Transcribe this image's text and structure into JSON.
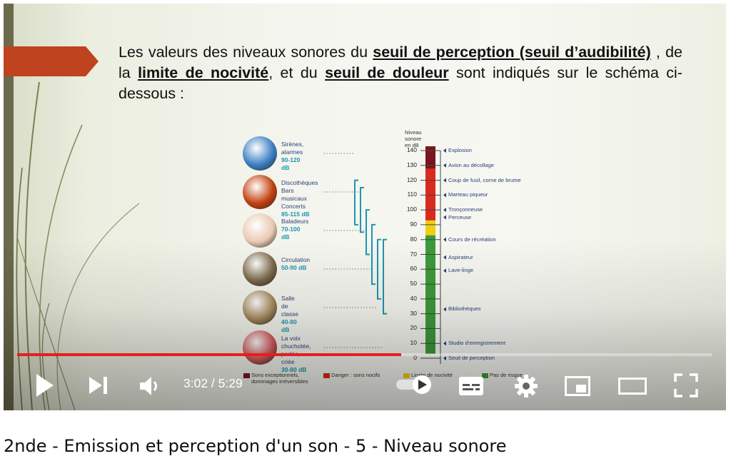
{
  "video": {
    "title": "2nde - Emission et perception d'un son - 5 - Niveau sonore",
    "current_time": "3:02",
    "separator": " / ",
    "duration": "5:29",
    "progress": 0.553
  },
  "controls": {
    "play": "play-icon",
    "next": "next-icon",
    "volume": "volume-icon",
    "autoplay": "autoplay-toggle",
    "subtitles": "subtitles-icon",
    "settings": "gear-icon",
    "miniplayer": "miniplayer-icon",
    "theater": "theater-icon",
    "fullscreen": "fullscreen-icon"
  },
  "slide": {
    "text_before": "Les valeurs des niveaux sonores du ",
    "term1": "seuil de perception (seuil d’audibilité)",
    "text_mid1": " , de la ",
    "term2": "limite de nocivité",
    "text_mid2": ", et du ",
    "term3": "seuil de douleur",
    "text_after": " sont indiqués sur le schéma ci-dessous :",
    "accent_color": "#c0431f",
    "diagram": {
      "scale_title": "Niveau sonore en dB",
      "ticks": [
        "140",
        "130",
        "120",
        "110",
        "100",
        "90",
        "80",
        "70",
        "60",
        "50",
        "40",
        "30",
        "20",
        "10",
        "0"
      ],
      "categories": [
        {
          "lines": [
            "Sirènes, alarmes"
          ],
          "range": "90-120 dB",
          "icon": "siren-icon"
        },
        {
          "lines": [
            "Discothèques",
            "Bars musicaux",
            "Concerts"
          ],
          "range": "85-115 dB",
          "icon": "concert-icon"
        },
        {
          "lines": [
            "Baladeurs"
          ],
          "range": "70-100 dB",
          "icon": "earphone-icon"
        },
        {
          "lines": [
            "Circulation"
          ],
          "range": "50-90 dB",
          "icon": "traffic-icon"
        },
        {
          "lines": [
            "Salle de classe"
          ],
          "range": "40-80 dB",
          "icon": "classroom-icon"
        },
        {
          "lines": [
            "La voix chuchotée,",
            "parlée, criée"
          ],
          "range": "30-80 dB",
          "icon": "mouth-icon"
        }
      ],
      "events": [
        {
          "db": 140,
          "label": "Explosion"
        },
        {
          "db": 130,
          "label": "Avion au décollage"
        },
        {
          "db": 120,
          "label": "Coup de fusil, corne de brume"
        },
        {
          "db": 110,
          "label": "Marteau piqueur"
        },
        {
          "db": 100,
          "label": "Tronçonneuse"
        },
        {
          "db": 95,
          "label": "Perceuse"
        },
        {
          "db": 80,
          "label": "Cours de récréation"
        },
        {
          "db": 68,
          "label": "Aspirateur"
        },
        {
          "db": 59,
          "label": "Lave-linge"
        },
        {
          "db": 33,
          "label": "Bibliothèques"
        },
        {
          "db": 10,
          "label": "Studio d'enregistrement"
        },
        {
          "db": 0,
          "label": "Seuil de perception"
        }
      ],
      "legend": [
        {
          "label": "Sons exceptionnels,",
          "label2": "dommages irréversibles",
          "color": "#7a1420"
        },
        {
          "label": "Danger : sons nocifs",
          "color": "#d92a20"
        },
        {
          "label": "Limite de nocivité",
          "color": "#f0cf10"
        },
        {
          "label": "Pas de risque",
          "color": "#3d9a3a"
        }
      ]
    }
  }
}
